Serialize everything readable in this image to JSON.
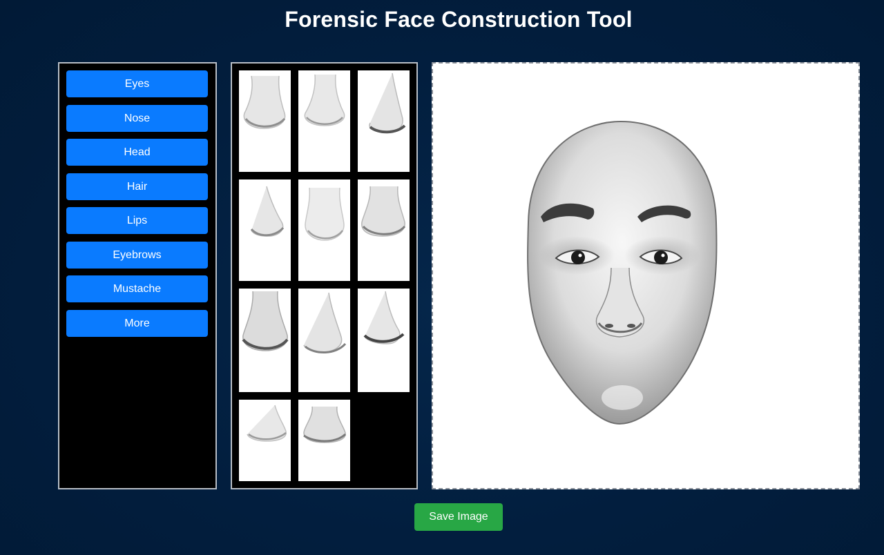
{
  "app": {
    "title": "Forensic Face Construction Tool"
  },
  "categories": [
    {
      "label": "Eyes"
    },
    {
      "label": "Nose"
    },
    {
      "label": "Head"
    },
    {
      "label": "Hair"
    },
    {
      "label": "Lips"
    },
    {
      "label": "Eyebrows"
    },
    {
      "label": "Mustache"
    },
    {
      "label": "More"
    }
  ],
  "feature_options": {
    "category_shown": "Nose",
    "count": 11,
    "icon": "nose-sketch-icon"
  },
  "canvas": {
    "content": "composite-face-sketch"
  },
  "actions": {
    "save_label": "Save Image"
  },
  "colors": {
    "background": "#011e3d",
    "category_button": "#0a7bff",
    "save_button": "#28a745",
    "panel": "#000000"
  }
}
